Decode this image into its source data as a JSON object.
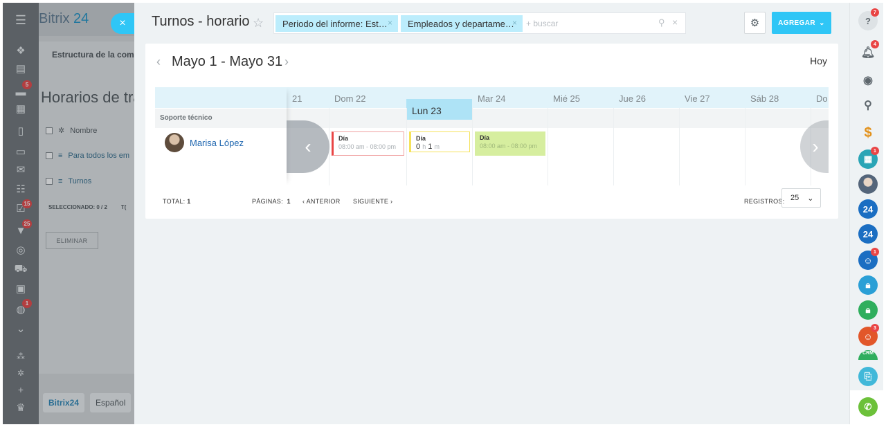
{
  "left_nav": {
    "badges": [
      "5",
      "15",
      "25",
      "1"
    ]
  },
  "background_page": {
    "brand": "Bitrix",
    "brand_num": "24",
    "structure_tab": "Estructura de la com",
    "heading": "Horarios de tra",
    "rows": [
      {
        "label": "Nombre"
      },
      {
        "label": "Para todos los em"
      },
      {
        "label": "Turnos"
      }
    ],
    "selected": "SELECCIONADO: 0 / 2",
    "selected_extra": "T(",
    "delete_button": "ELIMINAR",
    "footer_brand": "Bitrix24",
    "footer_lang": "Español"
  },
  "slider": {
    "close_icon": "×",
    "title": "Turnos - horario",
    "star_icon": "☆",
    "filters": [
      {
        "label": "Periodo del informe: Est…"
      },
      {
        "label": "Empleados y departame…"
      }
    ],
    "search_placeholder": "+ buscar",
    "add_button": "AGREGAR"
  },
  "calendar": {
    "period": "Mayo 1 - Mayo 31",
    "today_button": "Hoy",
    "days": [
      {
        "label": "21",
        "today": false
      },
      {
        "label": "Dom 22",
        "today": false
      },
      {
        "label": "Lun 23",
        "today": true
      },
      {
        "label": "Mar 24",
        "today": false
      },
      {
        "label": "Mié 25",
        "today": false
      },
      {
        "label": "Jue 26",
        "today": false
      },
      {
        "label": "Vie 27",
        "today": false
      },
      {
        "label": "Sáb 28",
        "today": false
      },
      {
        "label": "Do",
        "today": false
      }
    ],
    "department": "Soporte técnico",
    "employee": "Marisa López",
    "shifts": [
      {
        "title": "Día",
        "time": "08:00 am - 08:00 pm",
        "border": "#e94545",
        "bg": "#ffffff"
      },
      {
        "title": "Día",
        "dur_h": "0",
        "dur_h_unit": "h",
        "dur_m": "1",
        "dur_m_unit": "m",
        "border": "#f5e25a",
        "bg": "#ffffff"
      },
      {
        "title": "Día",
        "time": "08:00 am - 08:00 pm",
        "border": "#c9e59b",
        "bg": "#d6ee9f"
      }
    ]
  },
  "footer": {
    "total_label": "TOTAL:",
    "total_value": "1",
    "pages_label": "PÁGINAS:",
    "pages_value": "1",
    "prev": "ANTERIOR",
    "next": "SIGUIENTE",
    "records_label": "REGISTROS:",
    "records_value": "25"
  },
  "right_bar": {
    "badges": [
      "7",
      "4",
      "1",
      "1",
      "3"
    ],
    "counter_icon": "24",
    "crm_label": "CRM"
  },
  "colors": {
    "accent": "#2fc6f6",
    "today_header": "#aee3f6",
    "link": "#2067b0",
    "badge": "#e94545"
  }
}
